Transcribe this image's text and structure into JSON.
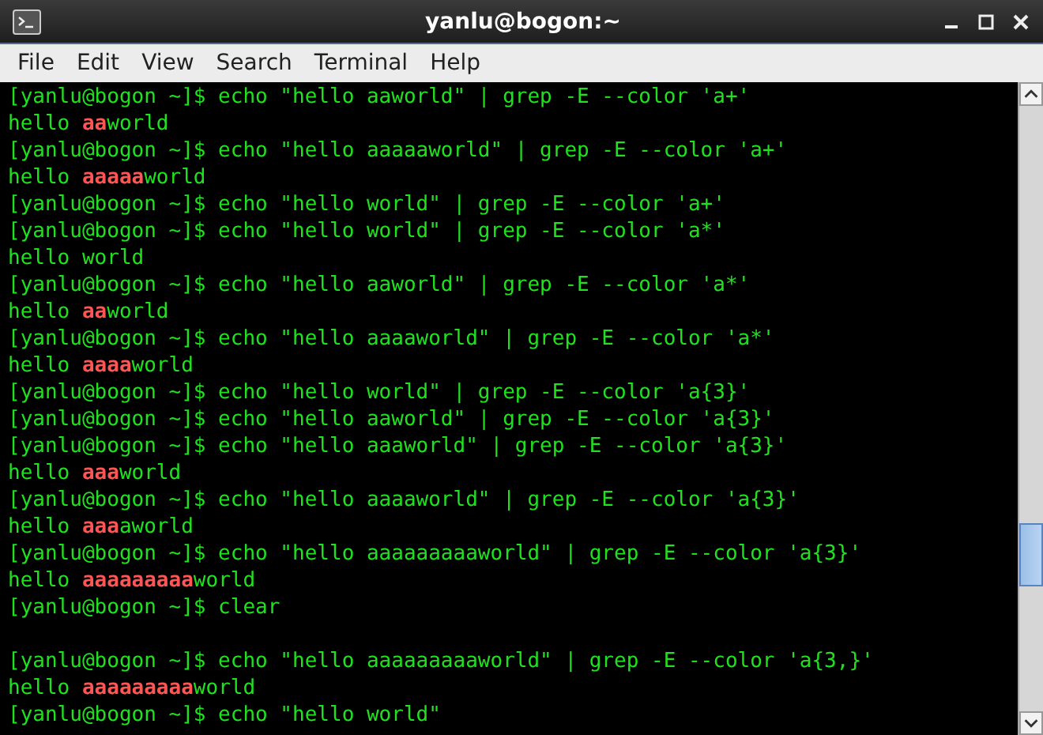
{
  "window": {
    "title": "yanlu@bogon:~"
  },
  "menu": [
    "File",
    "Edit",
    "View",
    "Search",
    "Terminal",
    "Help"
  ],
  "lines": [
    {
      "kind": "prompt",
      "text": "[yanlu@bogon ~]$ echo \"hello aaworld\" | grep -E --color 'a+'"
    },
    {
      "kind": "output",
      "parts": [
        {
          "text": "hello ",
          "match": false
        },
        {
          "text": "aa",
          "match": true
        },
        {
          "text": "world",
          "match": false
        }
      ]
    },
    {
      "kind": "prompt",
      "text": "[yanlu@bogon ~]$ echo \"hello aaaaaworld\" | grep -E --color 'a+'"
    },
    {
      "kind": "output",
      "parts": [
        {
          "text": "hello ",
          "match": false
        },
        {
          "text": "aaaaa",
          "match": true
        },
        {
          "text": "world",
          "match": false
        }
      ]
    },
    {
      "kind": "prompt",
      "text": "[yanlu@bogon ~]$ echo \"hello world\" | grep -E --color 'a+'"
    },
    {
      "kind": "prompt",
      "text": "[yanlu@bogon ~]$ echo \"hello world\" | grep -E --color 'a*'"
    },
    {
      "kind": "output",
      "parts": [
        {
          "text": "hello world",
          "match": false
        }
      ]
    },
    {
      "kind": "prompt",
      "text": "[yanlu@bogon ~]$ echo \"hello aaworld\" | grep -E --color 'a*'"
    },
    {
      "kind": "output",
      "parts": [
        {
          "text": "hello ",
          "match": false
        },
        {
          "text": "aa",
          "match": true
        },
        {
          "text": "world",
          "match": false
        }
      ]
    },
    {
      "kind": "prompt",
      "text": "[yanlu@bogon ~]$ echo \"hello aaaaworld\" | grep -E --color 'a*'"
    },
    {
      "kind": "output",
      "parts": [
        {
          "text": "hello ",
          "match": false
        },
        {
          "text": "aaaa",
          "match": true
        },
        {
          "text": "world",
          "match": false
        }
      ]
    },
    {
      "kind": "prompt",
      "text": "[yanlu@bogon ~]$ echo \"hello world\" | grep -E --color 'a{3}'"
    },
    {
      "kind": "prompt",
      "text": "[yanlu@bogon ~]$ echo \"hello aaworld\" | grep -E --color 'a{3}'"
    },
    {
      "kind": "prompt",
      "text": "[yanlu@bogon ~]$ echo \"hello aaaworld\" | grep -E --color 'a{3}'"
    },
    {
      "kind": "output",
      "parts": [
        {
          "text": "hello ",
          "match": false
        },
        {
          "text": "aaa",
          "match": true
        },
        {
          "text": "world",
          "match": false
        }
      ]
    },
    {
      "kind": "prompt",
      "text": "[yanlu@bogon ~]$ echo \"hello aaaaworld\" | grep -E --color 'a{3}'"
    },
    {
      "kind": "output",
      "parts": [
        {
          "text": "hello ",
          "match": false
        },
        {
          "text": "aaa",
          "match": true
        },
        {
          "text": "aworld",
          "match": false
        }
      ]
    },
    {
      "kind": "prompt",
      "text": "[yanlu@bogon ~]$ echo \"hello aaaaaaaaaworld\" | grep -E --color 'a{3}'"
    },
    {
      "kind": "output",
      "parts": [
        {
          "text": "hello ",
          "match": false
        },
        {
          "text": "aaaaaaaaa",
          "match": true
        },
        {
          "text": "world",
          "match": false
        }
      ]
    },
    {
      "kind": "prompt",
      "text": "[yanlu@bogon ~]$ clear"
    },
    {
      "kind": "blank"
    },
    {
      "kind": "prompt",
      "text": "[yanlu@bogon ~]$ echo \"hello aaaaaaaaaworld\" | grep -E --color 'a{3,}'"
    },
    {
      "kind": "output",
      "parts": [
        {
          "text": "hello ",
          "match": false
        },
        {
          "text": "aaaaaaaaa",
          "match": true
        },
        {
          "text": "world",
          "match": false
        }
      ]
    },
    {
      "kind": "prompt",
      "text": "[yanlu@bogon ~]$ echo \"hello world\""
    }
  ]
}
